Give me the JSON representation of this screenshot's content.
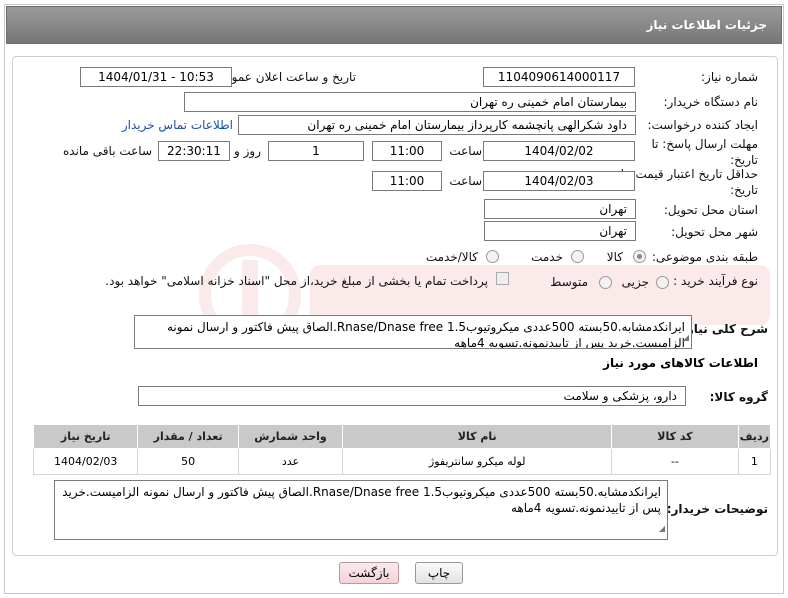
{
  "header": {
    "title": "جزئیات اطلاعات نیاز"
  },
  "form": {
    "need_number_label": "شماره نیاز:",
    "need_number": "1104090614000117",
    "announce_label": "تاریخ و ساعت اعلان عمومی:",
    "announce_value": "1404/01/31 - 10:53",
    "buyer_label": "نام دستگاه خریدار:",
    "buyer_value": "بیمارستان امام خمینی ره  تهران",
    "creator_label": "ایجاد کننده درخواست:",
    "creator_value": "داود شکرالهی پانچشمه کارپرداز بیمارستان امام خمینی ره  تهران",
    "contact_link": "اطلاعات تماس خریدار",
    "deadline_label": "مهلت ارسال پاسخ: تا تاریخ:",
    "deadline_date": "1404/02/02",
    "time_label": "ساعت",
    "deadline_time": "11:00",
    "days_value": "1",
    "days_label": "روز و",
    "remaining_time": "22:30:11",
    "remaining_label": "ساعت باقی مانده",
    "validity_label": "حداقل تاریخ اعتبار قیمت: تا تاریخ:",
    "validity_date": "1404/02/03",
    "validity_time": "11:00",
    "province_label": "استان محل تحویل:",
    "province_value": "تهران",
    "city_label": "شهر محل تحویل:",
    "city_value": "تهران",
    "category_label": "طبقه بندی موضوعی:",
    "category_options": [
      "کالا",
      "خدمت",
      "کالا/خدمت"
    ],
    "process_label": "نوع فرآیند خرید :",
    "process_options": [
      "جزیی",
      "متوسط"
    ],
    "process_note": "پرداخت تمام یا بخشی از مبلغ خرید،از محل \"اسناد خزانه اسلامی\" خواهد بود."
  },
  "description": {
    "label": "شرح کلی نیاز:",
    "text": "ایرانکدمشابه.50بسته 500عددی میکروتیوب1.5 Rnase/Dnase free.الصاق پیش فاکتور و ارسال نمونه الزامیست.خرید پس از تاییدنمونه.تسویه 4ماهه"
  },
  "goods": {
    "section_title": "اطلاعات کالاهای مورد نیاز",
    "group_label": "گروه کالا:",
    "group_value": "دارو، پزشکی و سلامت",
    "columns": [
      "ردیف",
      "کد کالا",
      "نام کالا",
      "واحد شمارش",
      "تعداد / مقدار",
      "تاریخ نیاز"
    ],
    "rows": [
      {
        "index": "1",
        "code": "--",
        "name": "لوله میکرو سانتریفوژ",
        "unit": "عدد",
        "qty": "50",
        "date": "1404/02/03"
      }
    ]
  },
  "buyer_notes": {
    "label": "توضیحات خریدار:",
    "text": "ایرانکدمشابه.50بسته 500عددی میکروتیوب1.5 Rnase/Dnase free.الصاق پیش فاکتور و ارسال نمونه الزامیست.خرید پس از تاییدنمونه.تسویه 4ماهه"
  },
  "buttons": {
    "print": "چاپ",
    "back": "بازگشت"
  },
  "colors": {
    "title_bg": "#8a8a8a",
    "link": "#1a4fb0",
    "table_header": "#c9c9c9",
    "back_button": "#f3d3d9"
  }
}
